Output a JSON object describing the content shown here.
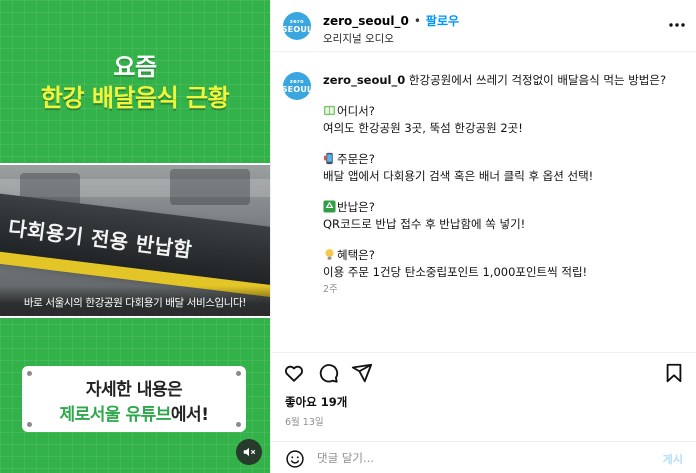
{
  "media": {
    "headline_line1": "요즘",
    "headline_line2": "한강 배달음식 근황",
    "sign_text": "다회용기 전용 반납함",
    "photo_caption": "바로 서울시의 한강공원 다회용기 배달 서비스입니다!",
    "callout_line1": "자세한 내용은",
    "callout_accent": "제로서울 유튜브",
    "callout_suffix": "에서!",
    "mute_icon": "speaker-muted-icon",
    "colors": {
      "background": "#34b24a",
      "headline_accent": "#f2f53c",
      "callout_accent": "#2ea84a"
    }
  },
  "header": {
    "avatar_top": "zero",
    "avatar_main": "SEOUL",
    "username": "zero_seoul_0",
    "separator": "•",
    "follow_label": "팔로우",
    "subtitle": "오리지널 오디오",
    "more_icon": "more-options-icon"
  },
  "caption": {
    "username": "zero_seoul_0",
    "intro": "한강공원에서 쓰레기 걱정없이 배달음식 먹는 방법은?",
    "blocks": [
      {
        "icon": "book-emoji",
        "title": "어디서?",
        "body": "여의도 한강공원 3곳, 뚝섬 한강공원 2곳!"
      },
      {
        "icon": "phone-emoji",
        "title": "주문은?",
        "body": "배달 앱에서 다회용기 검색 혹은 배너 클릭 후 옵션 선택!"
      },
      {
        "icon": "recycle-emoji",
        "title": "반납은?",
        "body": "QR코드로 반납 접수 후 반납함에 쏙 넣기!"
      },
      {
        "icon": "lightbulb-emoji",
        "title": "혜택은?",
        "body": "이용 주문 1건당 탄소중립포인트 1,000포인트씩 적립!"
      }
    ],
    "time_ago": "2주"
  },
  "actions": {
    "like_icon": "heart-icon",
    "comment_icon": "comment-icon",
    "share_icon": "share-icon",
    "save_icon": "bookmark-icon",
    "likes_text": "좋아요 19개",
    "date": "6월 13일"
  },
  "composer": {
    "emoji_icon": "emoji-icon",
    "placeholder": "댓글 달기...",
    "value": "",
    "post_label": "게시"
  }
}
